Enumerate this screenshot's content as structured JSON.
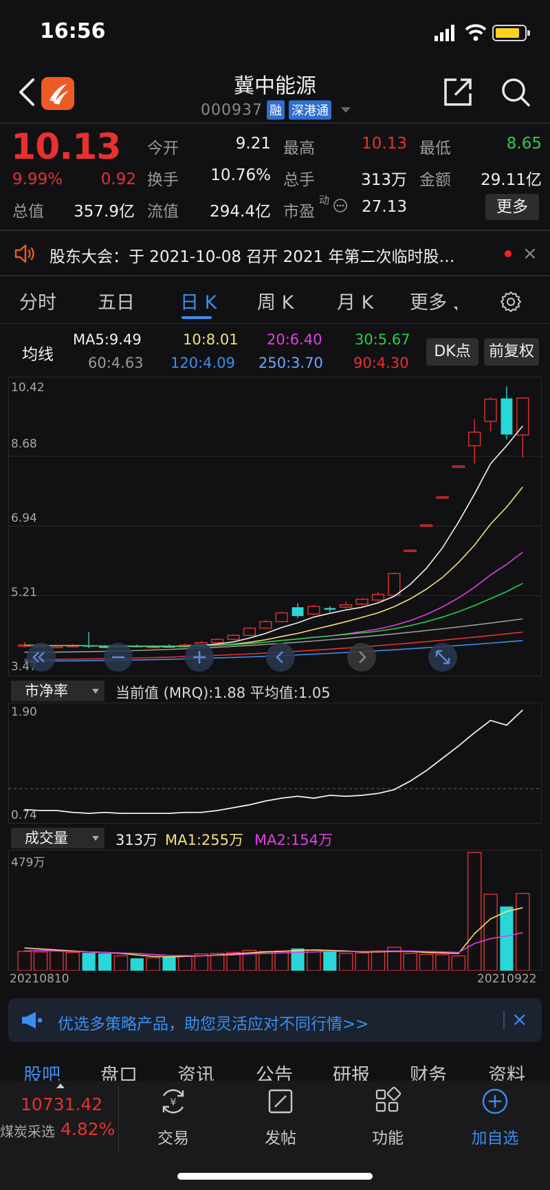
{
  "status_bar": {
    "time": "16:56"
  },
  "header": {
    "title": "冀中能源",
    "code": "000937",
    "tags": [
      "融",
      "深港通"
    ]
  },
  "quote": {
    "price": "10.13",
    "change_pct": "9.99%",
    "change": "0.92",
    "rows": [
      [
        {
          "label": "今开",
          "value": "9.21",
          "color": "white"
        },
        {
          "label": "最高",
          "value": "10.13",
          "color": "red"
        },
        {
          "label": "最低",
          "value": "8.65",
          "color": "green"
        }
      ],
      [
        {
          "label": "换手",
          "value": "10.76%",
          "color": "white"
        },
        {
          "label": "总手",
          "value": "313万",
          "color": "white"
        },
        {
          "label": "金额",
          "value": "29.11亿",
          "color": "white"
        }
      ],
      [
        {
          "label": "流值",
          "value": "294.4亿",
          "color": "white"
        },
        {
          "label": "市盈",
          "value": "27.13",
          "color": "white"
        }
      ]
    ],
    "total_value_label": "总值",
    "total_value": "357.9亿",
    "pe_sup": "动",
    "more_label": "更多"
  },
  "notice": {
    "text": "股东大会：于 2021-10-08 召开 2021 年第二次临时股…",
    "close": "×"
  },
  "period_tabs": [
    "分时",
    "五日",
    "日 K",
    "周 K",
    "月 K",
    "更多"
  ],
  "ma_row": {
    "title": "均线",
    "items": [
      {
        "text": "MA5:9.49",
        "color": "#f0f0f0"
      },
      {
        "text": "10:8.01",
        "color": "#f5e07a"
      },
      {
        "text": "20:6.40",
        "color": "#e040e0"
      },
      {
        "text": "30:5.67",
        "color": "#2dcc4a"
      },
      {
        "text": "60:4.63",
        "color": "#9a9a9a"
      },
      {
        "text": "120:4.09",
        "color": "#3b8ef0"
      },
      {
        "text": "250:3.70",
        "color": "#6ea8ff"
      },
      {
        "text": "90:4.30",
        "color": "#e8312f"
      }
    ],
    "dk_label": "DK点",
    "fq_label": "前复权"
  },
  "kline_axis": [
    "10.42",
    "8.68",
    "6.94",
    "5.21",
    "3.47"
  ],
  "pb_panel": {
    "select": "市净率",
    "text": "当前值 (MRQ):1.88  平均值:1.05",
    "axis_top": "1.90",
    "axis_bottom": "0.74"
  },
  "vol_panel": {
    "select": "成交量",
    "v": "313万",
    "ma1": "MA1:255万",
    "ma2": "MA2:154万",
    "axis_top": "479万",
    "date_start": "20210810",
    "date_end": "20210922"
  },
  "chart_data": {
    "type": "candlestick",
    "y_range": [
      3.47,
      10.42
    ],
    "candles": [
      [
        3.98,
        3.98,
        3.92,
        4.05
      ],
      [
        3.95,
        3.96,
        3.92,
        4.0
      ],
      [
        3.95,
        3.95,
        3.93,
        3.98
      ],
      [
        3.96,
        3.97,
        3.93,
        4.0
      ],
      [
        3.97,
        3.94,
        3.9,
        4.3
      ],
      [
        3.94,
        3.92,
        3.9,
        3.98
      ],
      [
        3.92,
        3.96,
        3.88,
        3.98
      ],
      [
        3.96,
        3.94,
        3.92,
        3.99
      ],
      [
        3.94,
        3.95,
        3.9,
        3.98
      ],
      [
        3.95,
        3.93,
        3.92,
        4.0
      ],
      [
        3.93,
        3.98,
        3.92,
        4.02
      ],
      [
        3.98,
        4.04,
        3.95,
        4.08
      ],
      [
        4.04,
        4.12,
        4.02,
        4.15
      ],
      [
        4.12,
        4.22,
        4.1,
        4.25
      ],
      [
        4.22,
        4.4,
        4.2,
        4.42
      ],
      [
        4.4,
        4.56,
        4.38,
        4.6
      ],
      [
        4.56,
        4.78,
        4.54,
        4.8
      ],
      [
        4.92,
        4.7,
        4.65,
        5.02
      ],
      [
        4.75,
        4.94,
        4.72,
        4.98
      ],
      [
        4.9,
        4.86,
        4.8,
        4.95
      ],
      [
        4.92,
        4.98,
        4.88,
        5.06
      ],
      [
        5.0,
        5.12,
        4.96,
        5.15
      ],
      [
        5.1,
        5.24,
        5.06,
        5.3
      ],
      [
        5.22,
        5.76,
        5.2,
        5.78
      ],
      [
        6.34,
        6.34,
        6.34,
        6.34
      ],
      [
        6.97,
        6.97,
        6.97,
        6.97
      ],
      [
        7.67,
        7.67,
        7.67,
        7.67
      ],
      [
        8.44,
        8.44,
        8.44,
        8.44
      ],
      [
        8.94,
        9.28,
        8.5,
        9.6
      ],
      [
        9.55,
        10.1,
        9.3,
        10.15
      ],
      [
        10.12,
        9.22,
        9.1,
        10.42
      ],
      [
        9.21,
        10.13,
        8.65,
        10.13
      ]
    ],
    "pb_range": [
      0.74,
      1.9
    ],
    "pb": [
      0.83,
      0.82,
      0.82,
      0.8,
      0.79,
      0.8,
      0.79,
      0.79,
      0.79,
      0.79,
      0.8,
      0.8,
      0.82,
      0.85,
      0.88,
      0.92,
      0.95,
      0.97,
      0.95,
      0.98,
      0.97,
      0.98,
      1.0,
      1.04,
      1.13,
      1.24,
      1.37,
      1.5,
      1.64,
      1.77,
      1.72,
      1.88
    ],
    "volume_range": [
      0,
      479
    ],
    "volume": [
      78,
      76,
      80,
      74,
      72,
      70,
      60,
      50,
      52,
      58,
      62,
      68,
      70,
      74,
      82,
      78,
      80,
      90,
      84,
      78,
      70,
      72,
      80,
      95,
      70,
      66,
      65,
      60,
      479,
      310,
      260,
      313
    ],
    "vol_ma1": [
      92,
      88,
      84,
      80,
      76,
      74,
      70,
      64,
      58,
      56,
      58,
      60,
      64,
      68,
      72,
      76,
      78,
      82,
      84,
      82,
      80,
      76,
      76,
      78,
      78,
      74,
      72,
      70,
      150,
      210,
      240,
      255
    ],
    "vol_ma2": [
      80,
      82,
      80,
      78,
      76,
      74,
      72,
      70,
      66,
      62,
      60,
      60,
      62,
      64,
      68,
      70,
      72,
      74,
      76,
      78,
      78,
      78,
      78,
      80,
      80,
      78,
      76,
      74,
      110,
      130,
      140,
      154
    ]
  },
  "promo": {
    "text": "优选多策略产品，助您灵活应对不同行情>>",
    "close": "×"
  },
  "bottom_tabs": [
    "股吧",
    "盘口",
    "资讯",
    "公告",
    "研报",
    "财务",
    "资料"
  ],
  "index": {
    "value": "10731.42",
    "name": "煤炭采选",
    "pct": "4.82%"
  },
  "nav": [
    "交易",
    "发帖",
    "功能",
    "加自选"
  ]
}
